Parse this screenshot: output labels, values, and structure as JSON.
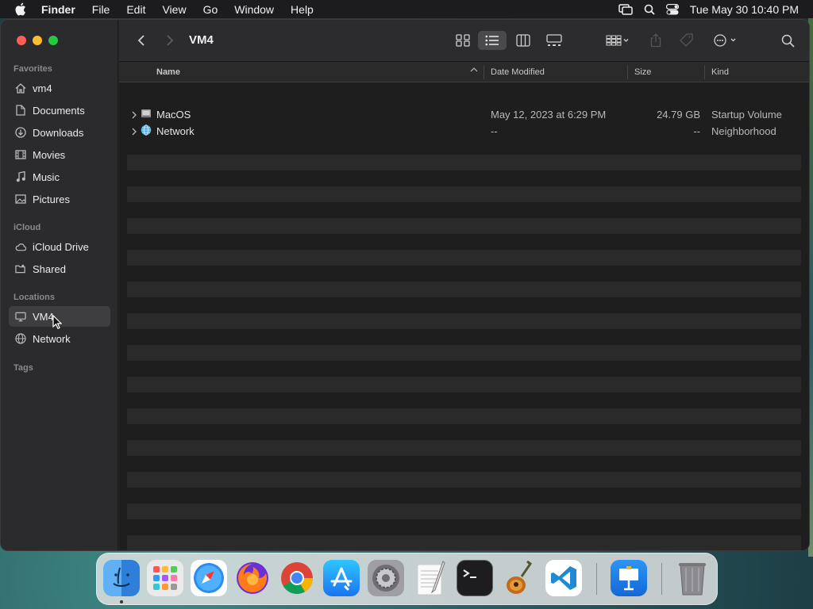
{
  "menubar": {
    "app_name": "Finder",
    "items": [
      "File",
      "Edit",
      "View",
      "Go",
      "Window",
      "Help"
    ],
    "datetime": "Tue May 30  10:40 PM"
  },
  "window": {
    "title": "VM4",
    "sidebar": {
      "favorites_header": "Favorites",
      "favorites": [
        {
          "label": "vm4",
          "icon": "home-icon"
        },
        {
          "label": "Documents",
          "icon": "document-icon"
        },
        {
          "label": "Downloads",
          "icon": "download-icon"
        },
        {
          "label": "Movies",
          "icon": "film-icon"
        },
        {
          "label": "Music",
          "icon": "music-icon"
        },
        {
          "label": "Pictures",
          "icon": "photo-icon"
        }
      ],
      "icloud_header": "iCloud",
      "icloud": [
        {
          "label": "iCloud Drive",
          "icon": "cloud-icon"
        },
        {
          "label": "Shared",
          "icon": "shared-folder-icon"
        }
      ],
      "locations_header": "Locations",
      "locations": [
        {
          "label": "VM4",
          "icon": "computer-icon",
          "selected": true
        },
        {
          "label": "Network",
          "icon": "globe-icon"
        }
      ],
      "tags_header": "Tags"
    },
    "columns": {
      "name": "Name",
      "date": "Date Modified",
      "size": "Size",
      "kind": "Kind"
    },
    "files": [
      {
        "name": "MacOS",
        "date": "May 12, 2023 at 6:29 PM",
        "size": "24.79 GB",
        "kind": "Startup Volume",
        "icon": "disk-icon"
      },
      {
        "name": "Network",
        "date": "--",
        "size": "--",
        "kind": "Neighborhood",
        "icon": "globe-icon"
      }
    ]
  },
  "dock": {
    "apps": [
      "Finder",
      "Launchpad",
      "Safari",
      "Firefox",
      "Chrome",
      "App Store",
      "System Settings",
      "TextEdit",
      "Terminal",
      "GarageBand",
      "Visual Studio Code",
      "Keynote",
      "Trash"
    ]
  },
  "colors": {
    "accent_red": "#ff5f57",
    "accent_yellow": "#febc2e",
    "accent_green": "#28c840",
    "window_bg": "#1e1e1e",
    "sidebar_bg": "#2b2b2d"
  }
}
